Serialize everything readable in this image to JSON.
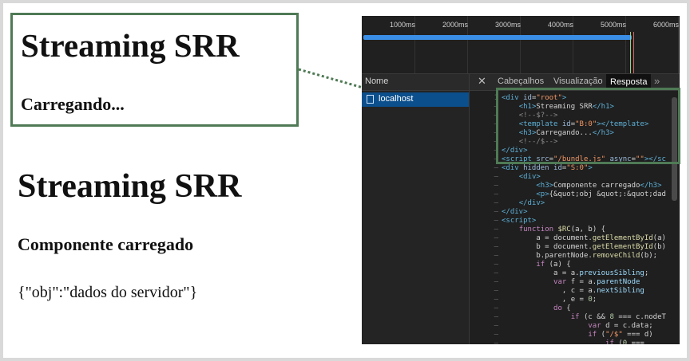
{
  "zoomed_view": {
    "title": "Streaming SRR",
    "loading_text": "Carregando..."
  },
  "page_view": {
    "title": "Streaming SRR",
    "subtitle": "Componente carregado",
    "data_text": "{\"obj\":\"dados do servidor\"}"
  },
  "devtools": {
    "timeline_ticks": [
      "1000ms",
      "2000ms",
      "3000ms",
      "4000ms",
      "5000ms",
      "6000ms"
    ],
    "name_column_header": "Nome",
    "request_name": "localhost",
    "tabs": [
      {
        "label": "Cabeçalhos",
        "active": false
      },
      {
        "label": "Visualização",
        "active": false
      },
      {
        "label": "Resposta",
        "active": true
      }
    ],
    "close_glyph": "✕",
    "more_tabs_glyph": "»",
    "colors": {
      "highlight_border": "#4f7a55",
      "timeline_bar": "#3b8ee6",
      "selected_row": "#0b4f8c"
    },
    "response_lines": [
      {
        "n": "1",
        "tokens": [
          [
            "tag",
            "<div "
          ],
          [
            "attr",
            "id"
          ],
          [
            "pl",
            "="
          ],
          [
            "str",
            "\"root\""
          ],
          [
            "tag",
            ">"
          ]
        ]
      },
      {
        "n": "–",
        "tokens": [
          [
            "pl",
            "    "
          ],
          [
            "tag",
            "<h1>"
          ],
          [
            "pl",
            "Streaming SRR"
          ],
          [
            "tag",
            "</h1>"
          ]
        ]
      },
      {
        "n": "–",
        "tokens": [
          [
            "pl",
            "    "
          ],
          [
            "com",
            "<!--$?-->"
          ]
        ]
      },
      {
        "n": "–",
        "tokens": [
          [
            "pl",
            "    "
          ],
          [
            "tag",
            "<template "
          ],
          [
            "attr",
            "id"
          ],
          [
            "pl",
            "="
          ],
          [
            "str",
            "\"B:0\""
          ],
          [
            "tag",
            "></template>"
          ]
        ]
      },
      {
        "n": "–",
        "tokens": [
          [
            "pl",
            "    "
          ],
          [
            "tag",
            "<h3>"
          ],
          [
            "pl",
            "Carregando..."
          ],
          [
            "tag",
            "</h3>"
          ]
        ]
      },
      {
        "n": "–",
        "tokens": [
          [
            "pl",
            "    "
          ],
          [
            "com",
            "<!--/$-->"
          ]
        ]
      },
      {
        "n": "–",
        "tokens": [
          [
            "tag",
            "</div>"
          ]
        ]
      },
      {
        "n": "–",
        "tokens": [
          [
            "tag",
            "<script "
          ],
          [
            "attr",
            "src"
          ],
          [
            "pl",
            "="
          ],
          [
            "str",
            "\"/bundle.js\""
          ],
          [
            "pl",
            " "
          ],
          [
            "attr",
            "async"
          ],
          [
            "pl",
            "="
          ],
          [
            "str",
            "\"\""
          ],
          [
            "tag",
            "></sc"
          ]
        ]
      },
      {
        "n": "–",
        "tokens": [
          [
            "tag",
            "<div "
          ],
          [
            "attr",
            "hidden"
          ],
          [
            "pl",
            " "
          ],
          [
            "attr",
            "id"
          ],
          [
            "pl",
            "="
          ],
          [
            "str",
            "\"S:0\""
          ],
          [
            "tag",
            ">"
          ]
        ]
      },
      {
        "n": "–",
        "tokens": [
          [
            "pl",
            "    "
          ],
          [
            "tag",
            "<div>"
          ]
        ]
      },
      {
        "n": "–",
        "tokens": [
          [
            "pl",
            "        "
          ],
          [
            "tag",
            "<h3>"
          ],
          [
            "pl",
            "Componente carregado"
          ],
          [
            "tag",
            "</h3>"
          ]
        ]
      },
      {
        "n": "–",
        "tokens": [
          [
            "pl",
            "        "
          ],
          [
            "tag",
            "<p>"
          ],
          [
            "pl",
            "{&quot;obj &quot;:&quot;dad"
          ]
        ]
      },
      {
        "n": "–",
        "tokens": [
          [
            "pl",
            "    "
          ],
          [
            "tag",
            "</div>"
          ]
        ]
      },
      {
        "n": "–",
        "tokens": [
          [
            "tag",
            "</div>"
          ]
        ]
      },
      {
        "n": "–",
        "tokens": [
          [
            "tag",
            "<script>"
          ]
        ]
      },
      {
        "n": "–",
        "tokens": [
          [
            "pl",
            "    "
          ],
          [
            "kw",
            "function "
          ],
          [
            "fn",
            "$RC"
          ],
          [
            "pl",
            "(a, b) {"
          ]
        ]
      },
      {
        "n": "–",
        "tokens": [
          [
            "pl",
            "        a = document."
          ],
          [
            "fn",
            "getElementById"
          ],
          [
            "pl",
            "(a)"
          ]
        ]
      },
      {
        "n": "–",
        "tokens": [
          [
            "pl",
            "        b = document."
          ],
          [
            "fn",
            "getElementById"
          ],
          [
            "pl",
            "(b)"
          ]
        ]
      },
      {
        "n": "–",
        "tokens": [
          [
            "pl",
            "        b.parentNode."
          ],
          [
            "fn",
            "removeChild"
          ],
          [
            "pl",
            "(b);"
          ]
        ]
      },
      {
        "n": "–",
        "tokens": [
          [
            "pl",
            "        "
          ],
          [
            "kw",
            "if "
          ],
          [
            "pl",
            "(a) {"
          ]
        ]
      },
      {
        "n": "–",
        "tokens": [
          [
            "pl",
            "            a = a."
          ],
          [
            "var",
            "previousSibling"
          ],
          [
            "pl",
            ";"
          ]
        ]
      },
      {
        "n": "–",
        "tokens": [
          [
            "pl",
            "            "
          ],
          [
            "kw",
            "var "
          ],
          [
            "pl",
            "f = a."
          ],
          [
            "var",
            "parentNode"
          ]
        ]
      },
      {
        "n": "–",
        "tokens": [
          [
            "pl",
            "              , c = a."
          ],
          [
            "var",
            "nextSibling"
          ]
        ]
      },
      {
        "n": "–",
        "tokens": [
          [
            "pl",
            "              , e = "
          ],
          [
            "num",
            "0"
          ],
          [
            "pl",
            ";"
          ]
        ]
      },
      {
        "n": "–",
        "tokens": [
          [
            "pl",
            "            "
          ],
          [
            "kw",
            "do "
          ],
          [
            "pl",
            "{"
          ]
        ]
      },
      {
        "n": "–",
        "tokens": [
          [
            "pl",
            "                "
          ],
          [
            "kw",
            "if "
          ],
          [
            "pl",
            "(c && "
          ],
          [
            "num",
            "8"
          ],
          [
            "pl",
            " === c.nodeT"
          ]
        ]
      },
      {
        "n": "–",
        "tokens": [
          [
            "pl",
            "                    "
          ],
          [
            "kw",
            "var "
          ],
          [
            "pl",
            "d = c.data;"
          ]
        ]
      },
      {
        "n": "–",
        "tokens": [
          [
            "pl",
            "                    "
          ],
          [
            "kw",
            "if "
          ],
          [
            "pl",
            "("
          ],
          [
            "str",
            "\"/$\""
          ],
          [
            "pl",
            " === d)"
          ]
        ]
      },
      {
        "n": "–",
        "tokens": [
          [
            "pl",
            "                        "
          ],
          [
            "kw",
            "if "
          ],
          [
            "pl",
            "("
          ],
          [
            "num",
            "0"
          ],
          [
            "pl",
            " ==="
          ]
        ]
      }
    ]
  }
}
